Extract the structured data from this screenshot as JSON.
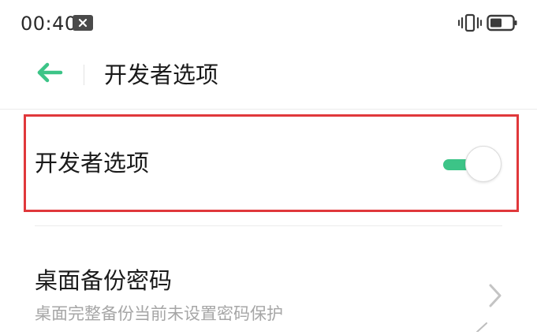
{
  "status_bar": {
    "time": "00:40",
    "icons": [
      "notification-close-icon",
      "vibrate-icon",
      "battery-icon"
    ]
  },
  "header": {
    "back_icon": "arrow-left-icon",
    "title": "开发者选项"
  },
  "settings": {
    "developer_options": {
      "label": "开发者选项",
      "toggle_on": true
    },
    "desktop_backup_password": {
      "label": "桌面备份密码",
      "subtitle": "桌面完整备份当前未设置密码保护",
      "chevron_icon": "chevron-right-icon"
    }
  },
  "colors": {
    "accent_green": "#3cc487",
    "highlight_red": "#e0383b",
    "subtitle_gray": "#a6a6a6"
  }
}
